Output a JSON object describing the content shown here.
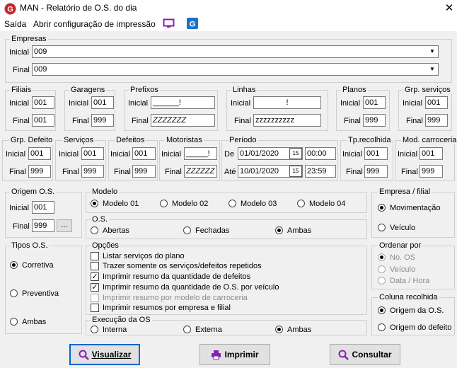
{
  "window": {
    "title": "MAN - Relatório de O.S. do dia",
    "close": "✕"
  },
  "menu": {
    "exit": "Saída",
    "print_config": "Abrir configuração de impressão"
  },
  "labels": {
    "inicial": "Inicial",
    "final": "Final",
    "de": "De",
    "ate": "Até"
  },
  "empresas": {
    "legend": "Empresas",
    "inicial": "009",
    "final": "009"
  },
  "filiais": {
    "legend": "Filiais",
    "inicial": "001",
    "final": "001"
  },
  "garagens": {
    "legend": "Garagens",
    "inicial": "001",
    "final": "999"
  },
  "prefixos": {
    "legend": "Prefixos",
    "inicial": "______!",
    "final": "ZZZZZZZ"
  },
  "linhas": {
    "legend": "Linhas",
    "inicial": "!",
    "final": "zzzzzzzzzz"
  },
  "planos": {
    "legend": "Planos",
    "inicial": "001",
    "final": "999"
  },
  "grp_servicos": {
    "legend": "Grp. serviços",
    "inicial": "001",
    "final": "999"
  },
  "grp_defeito": {
    "legend": "Grp. Defeito",
    "inicial": "001",
    "final": "999"
  },
  "servicos": {
    "legend": "Serviços",
    "inicial": "001",
    "final": "999"
  },
  "defeitos": {
    "legend": "Defeitos",
    "inicial": "001",
    "final": "999"
  },
  "motoristas": {
    "legend": "Motoristas",
    "inicial": "_____!",
    "final": "ZZZZZZ"
  },
  "periodo": {
    "legend": "Período",
    "de_date": "01/01/2020",
    "de_time": "00:00",
    "ate_date": "10/01/2020",
    "ate_time": "23:59",
    "cal": "15"
  },
  "tp_recolhida": {
    "legend": "Tp.recolhida",
    "inicial": "001",
    "final": "999"
  },
  "mod_carroceria": {
    "legend": "Mod. carroceria",
    "inicial": "001",
    "final": "999"
  },
  "origem_os": {
    "legend": "Origem O.S.",
    "inicial": "001",
    "final": "999",
    "dots": "..."
  },
  "modelo": {
    "legend": "Modelo",
    "options": [
      "Modelo 01",
      "Modelo 02",
      "Modelo 03",
      "Modelo 04"
    ]
  },
  "os": {
    "legend": "O.S.",
    "options": [
      "Abertas",
      "Fechadas",
      "Ambas"
    ]
  },
  "empresa_filial": {
    "legend": "Empresa / filial",
    "options": [
      "Movimentação",
      "Veículo"
    ]
  },
  "tipos_os": {
    "legend": "Tipos O.S.",
    "options": [
      "Corretiva",
      "Preventiva",
      "Ambas"
    ]
  },
  "opcoes": {
    "legend": "Opções",
    "items": [
      "Listar serviços do plano",
      "Trazer somente os serviços/defeitos repetidos",
      "Imprimir resumo da quantidade de defeitos",
      "Imprimir resumo da quantidade de O.S. por veículo",
      "Imprimir resumo por modelo de carroceria",
      "Imprimir resumos por empresa e filial"
    ]
  },
  "execucao": {
    "legend": "Execução da OS",
    "options": [
      "Interna",
      "Externa",
      "Ambas"
    ]
  },
  "ordenar": {
    "legend": "Ordenar por",
    "options": [
      "No. OS",
      "Veículo",
      "Data / Hora"
    ]
  },
  "coluna_recolhida": {
    "legend": "Coluna recolhida",
    "options": [
      "Origem da O.S.",
      "Origem do defeito"
    ]
  },
  "buttons": {
    "visualizar": "Visualizar",
    "imprimir": "Imprimir",
    "consultar": "Consultar"
  },
  "colors": {
    "accent": "#0066cc",
    "icon_red": "#c4262e",
    "icon_purple": "#8a1fb8",
    "icon_blue": "#1a73c8"
  }
}
